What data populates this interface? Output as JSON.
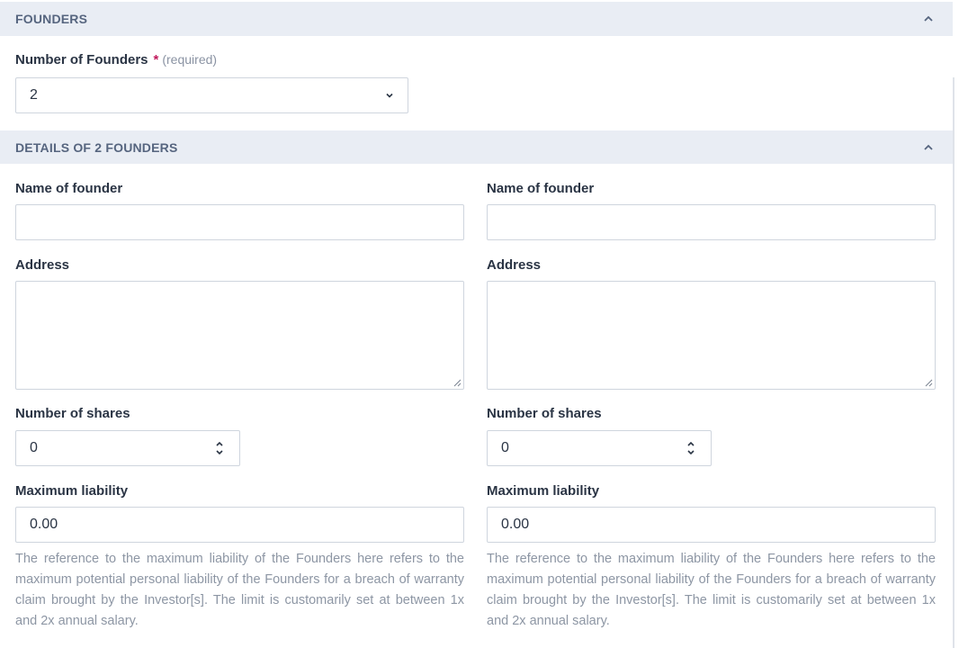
{
  "founders_section": {
    "title": "FOUNDERS",
    "number_label": "Number of Founders",
    "required_star": "*",
    "required_text": "(required)",
    "number_value": "2"
  },
  "details_section": {
    "title": "DETAILS OF 2 FOUNDERS"
  },
  "founders": [
    {
      "name_label": "Name of founder",
      "name_value": "",
      "address_label": "Address",
      "address_value": "",
      "shares_label": "Number of shares",
      "shares_value": "0",
      "liability_label": "Maximum liability",
      "liability_value": "0.00",
      "help_text": "The reference to the maximum liability of the Founders here refers to the maximum potential personal liability of the Founders for a breach of warranty claim brought by the Investor[s]. The limit is customarily set at between 1x and 2x annual salary."
    },
    {
      "name_label": "Name of founder",
      "name_value": "",
      "address_label": "Address",
      "address_value": "",
      "shares_label": "Number of shares",
      "shares_value": "0",
      "liability_label": "Maximum liability",
      "liability_value": "0.00",
      "help_text": "The reference to the maximum liability of the Founders here refers to the maximum potential personal liability of the Founders for a breach of warranty claim brought by the Investor[s]. The limit is customarily set at between 1x and 2x annual salary."
    }
  ],
  "icons": {
    "collapse": "chevron-up-icon",
    "dropdown": "chevron-down-icon",
    "stepper": "spinner-arrows-icon",
    "resize": "resize-grip-icon"
  },
  "colors": {
    "header_bg": "#e9edf4",
    "header_text": "#56657f",
    "required_star": "#c0185b",
    "border": "#cfd5de",
    "help_text": "#8d96a4"
  }
}
